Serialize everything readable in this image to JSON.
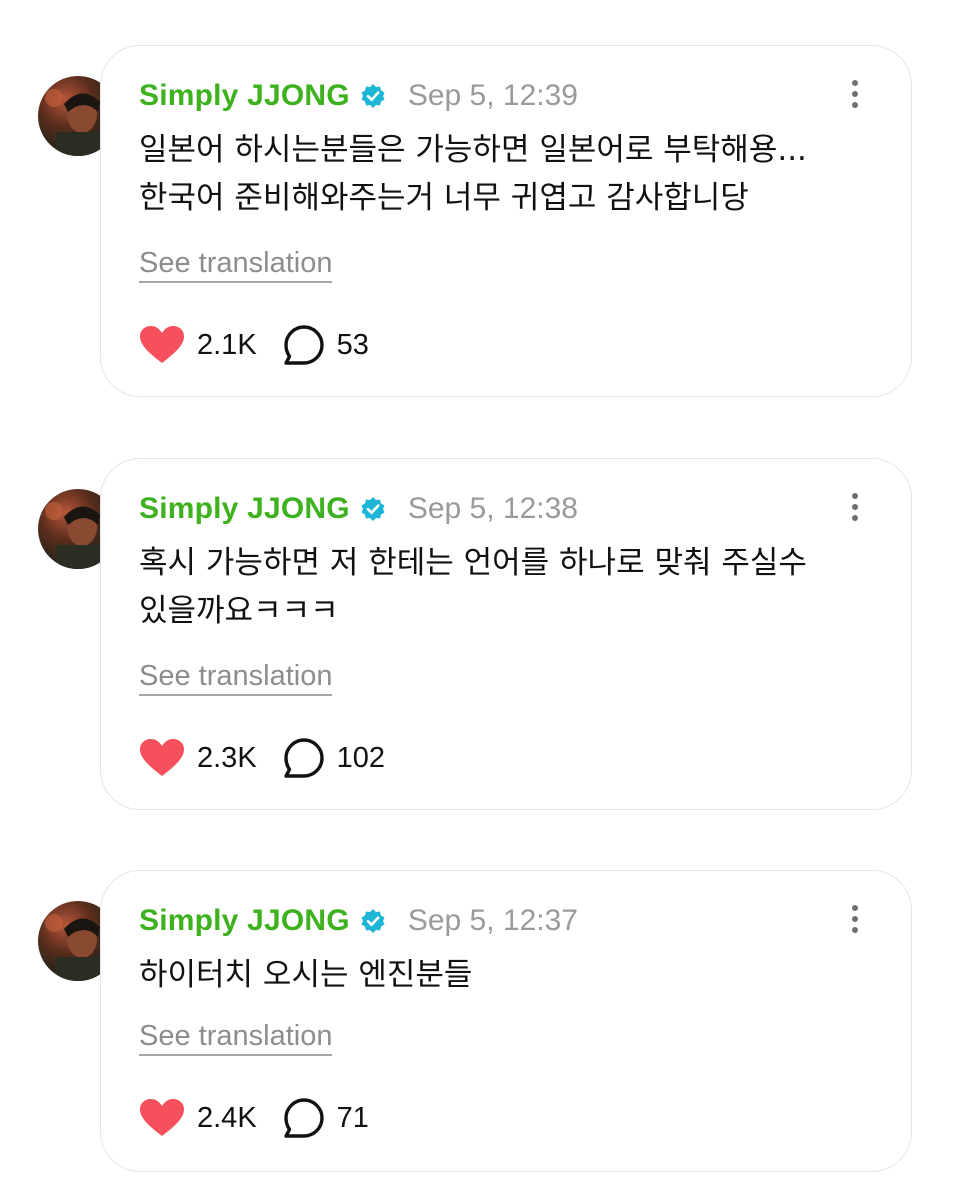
{
  "posts": [
    {
      "author": "Simply JJONG",
      "time": "Sep 5, 12:39",
      "text_lines": [
        "일본어 하시는분들은 가능하면 일본어로 부탁해용...",
        "한국어 준비해와주는거 너무 귀엽고 감사합니당"
      ],
      "see_translation": "See translation",
      "likes": "2.1K",
      "comments": "53"
    },
    {
      "author": "Simply JJONG",
      "time": "Sep 5, 12:38",
      "text_lines": [
        "혹시 가능하면 저 한테는 언어를 하나로 맞춰 주실수",
        "있을까요ㅋㅋㅋ"
      ],
      "see_translation": "See translation",
      "likes": "2.3K",
      "comments": "102"
    },
    {
      "author": "Simply JJONG",
      "time": "Sep 5, 12:37",
      "text_lines": [
        "하이터치 오시는 엔진분들"
      ],
      "see_translation": "See translation",
      "likes": "2.4K",
      "comments": "71"
    }
  ],
  "icons": {
    "verified": "verified-badge-icon",
    "like": "heart-icon",
    "comment": "comment-bubble-icon",
    "more": "more-options-icon"
  },
  "colors": {
    "author": "#3eb11e",
    "verified": "#1db6d6",
    "heart": "#f5505c",
    "timestamp": "#9a9a9a"
  }
}
